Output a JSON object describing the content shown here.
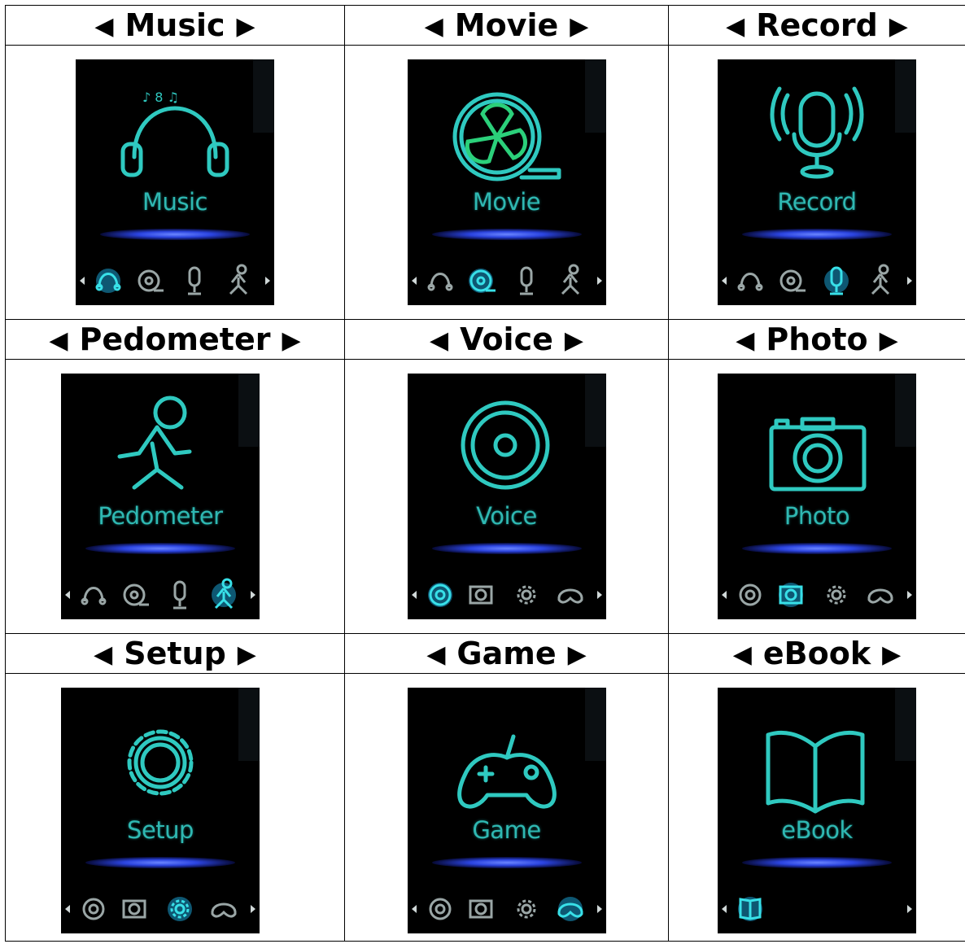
{
  "cells": [
    {
      "title": "Music",
      "screen_label": "Music",
      "icon": "headphones-icon",
      "bar_set": 1,
      "selected": 0
    },
    {
      "title": "Movie",
      "screen_label": "Movie",
      "icon": "film-reel-icon",
      "bar_set": 1,
      "selected": 1
    },
    {
      "title": "Record",
      "screen_label": "Record",
      "icon": "microphone-icon",
      "bar_set": 1,
      "selected": 2
    },
    {
      "title": "Pedometer",
      "screen_label": "Pedometer",
      "icon": "runner-icon",
      "bar_set": 1,
      "selected": 3
    },
    {
      "title": "Voice",
      "screen_label": "Voice",
      "icon": "speaker-icon",
      "bar_set": 2,
      "selected": 0
    },
    {
      "title": "Photo",
      "screen_label": "Photo",
      "icon": "camera-icon",
      "bar_set": 2,
      "selected": 1
    },
    {
      "title": "Setup",
      "screen_label": "Setup",
      "icon": "gear-icon",
      "bar_set": 2,
      "selected": 2
    },
    {
      "title": "Game",
      "screen_label": "Game",
      "icon": "gamepad-icon",
      "bar_set": 2,
      "selected": 3
    },
    {
      "title": "eBook",
      "screen_label": "eBook",
      "icon": "book-icon",
      "bar_set": 3,
      "selected": 0
    }
  ],
  "arrows": {
    "left": "◀",
    "right": "▶"
  },
  "colors": {
    "icon": "#2fc9c0",
    "icon_dim": "#9aa6a6",
    "glow": "#3b55f0",
    "screen_bg": "#000000"
  }
}
